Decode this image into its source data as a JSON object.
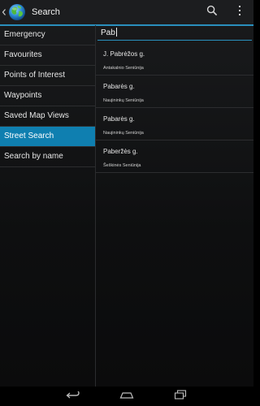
{
  "actionbar": {
    "title": "Search",
    "up_icon": "chevron-left-icon",
    "app_icon": "globe-icon",
    "search_icon": "search-icon",
    "overflow_icon": "more-vertical-icon"
  },
  "menu": {
    "items": [
      {
        "label": "Emergency"
      },
      {
        "label": "Favourites"
      },
      {
        "label": "Points of Interest"
      },
      {
        "label": "Waypoints"
      },
      {
        "label": "Saved Map Views"
      },
      {
        "label": "Street Search"
      },
      {
        "label": "Search by name"
      }
    ],
    "selected": "Street Search"
  },
  "search": {
    "value": "Pab"
  },
  "results": [
    {
      "street": "J. Pabrėžos g.",
      "area": "Antakalnio Seniūnija"
    },
    {
      "street": "Pabarės g.",
      "area": "Naujininkų Seniūnija"
    },
    {
      "street": "Pabarės g.",
      "area": "Naujininkų Seniūnija"
    },
    {
      "street": "Paberžės g.",
      "area": "Šeškinės Seniūnija"
    }
  ],
  "navbar": {
    "back_icon": "back-icon",
    "home_icon": "home-icon",
    "recents_icon": "recent-apps-icon"
  },
  "colors": {
    "accent": "#2a8fbd",
    "selected_bg": "#0f7fb0",
    "background": "#0e0f10"
  }
}
